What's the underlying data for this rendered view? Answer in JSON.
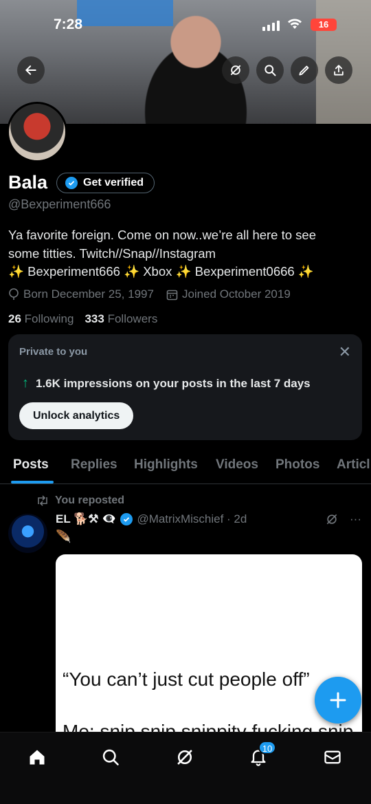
{
  "status": {
    "time": "7:28",
    "battery": "16"
  },
  "profile": {
    "name": "Bala",
    "get_verified": "Get verified",
    "handle": "@Bexperiment666",
    "bio_lines": [
      "Ya favorite foreign. Come on now..we’re all here to see",
      "some titties. Twitch//Snap//Instagram",
      "✨ Bexperiment666 ✨ Xbox ✨ Bexperiment0666 ✨"
    ],
    "born": "Born December 25, 1997",
    "joined": "Joined October 2019",
    "following_count": "26",
    "following_label": "Following",
    "followers_count": "333",
    "followers_label": "Followers"
  },
  "analytics_card": {
    "title": "Private to you",
    "impressions": "1.6K impressions on your posts in the last 7 days",
    "unlock": "Unlock analytics"
  },
  "tabs": [
    "Posts",
    "Replies",
    "Highlights",
    "Videos",
    "Photos",
    "Articl"
  ],
  "post": {
    "repost_label": "You reposted",
    "author": "EL 🐕⚒ 👁‍🗨",
    "handle_time": "@MatrixMischief · 2d",
    "emoji_line": "🪶",
    "media_line1": "“You can’t just cut people off”",
    "media_line2": "Me: snip snip snippity fucking snip"
  },
  "nav": {
    "notifications_badge": "10"
  },
  "colors": {
    "accent": "#1d9bf0",
    "green": "#00ba7c",
    "battery": "#ff453a"
  }
}
